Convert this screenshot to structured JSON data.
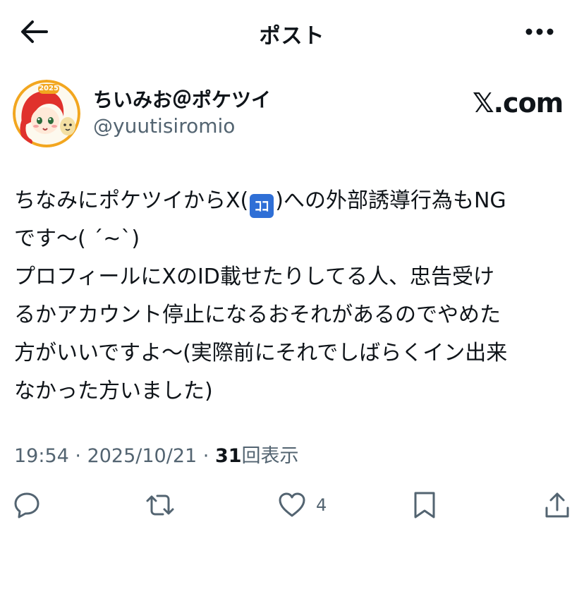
{
  "header": {
    "title": "ポスト"
  },
  "author": {
    "display_name": "ちいみお＠ポケツイ",
    "handle": "@yuutisiromio",
    "avatar_badge_text": "2025"
  },
  "brand": {
    "label": "𝕏.com"
  },
  "post": {
    "line1_before": "ちなみにポケツイからX(",
    "badge": "ｺｺ",
    "line1_after": ")への外部誘導行為もNG",
    "lines": [
      "です〜( ´~`)",
      "プロフィールにXのID載せたりしてる人、忠告受け",
      "るかアカウント停止になるおそれがあるのでやめた",
      "方がいいですよ〜(実際前にそれでしばらくイン出来",
      "なかった方いました)"
    ]
  },
  "meta": {
    "time": "19:54",
    "separator1": " · ",
    "date": "2025/10/21",
    "separator2": " · ",
    "views_count": "31",
    "views_label": "回表示"
  },
  "actions": {
    "reply_count": "",
    "retweet_count": "",
    "like_count": "4"
  },
  "colors": {
    "text": "#0f1419",
    "secondary": "#536471",
    "badge_blue": "#2f6fd6"
  }
}
